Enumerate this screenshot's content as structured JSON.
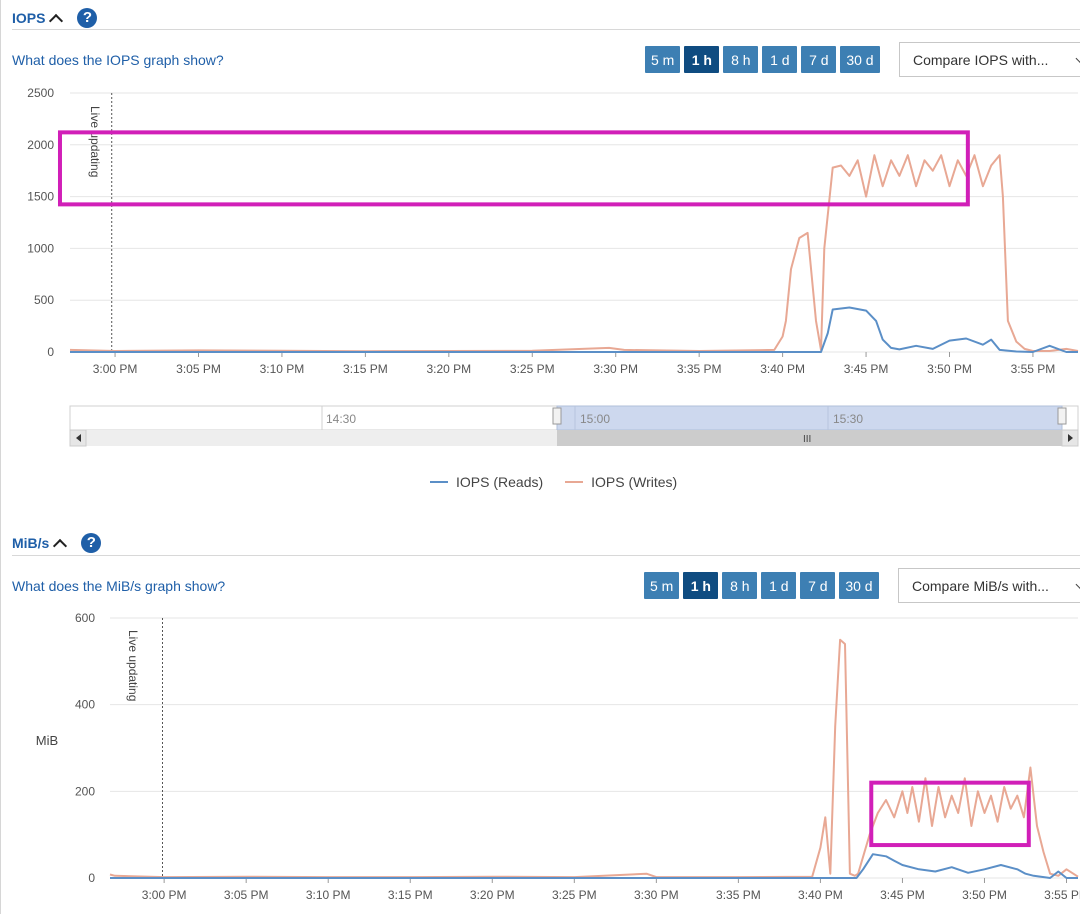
{
  "sections": [
    {
      "title": "IOPS",
      "help_link": "What does the IOPS graph show?",
      "ranges": [
        "5 m",
        "1 h",
        "8 h",
        "1 d",
        "7 d",
        "30 d"
      ],
      "active_range": "1 h",
      "compare_label": "Compare IOPS with...",
      "live_label": "Live updating"
    },
    {
      "title": "MiB/s",
      "help_link": "What does the MiB/s graph show?",
      "ranges": [
        "5 m",
        "1 h",
        "8 h",
        "1 d",
        "7 d",
        "30 d"
      ],
      "active_range": "1 h",
      "compare_label": "Compare MiB/s with...",
      "live_label": "Live updating"
    }
  ],
  "navigator": {
    "labels": [
      "14:30",
      "15:00",
      "15:30"
    ]
  },
  "legend": [
    {
      "name": "IOPS (Reads)",
      "color": "#5b8fc7"
    },
    {
      "name": "IOPS (Writes)",
      "color": "#e8a894"
    }
  ],
  "colors": {
    "reads": "#5b8fc7",
    "writes": "#e8a894",
    "highlight": "#d11fb8",
    "accent": "#1f5fa8"
  },
  "chart_data": [
    {
      "type": "line",
      "ylabel": "",
      "ylim": [
        0,
        2500
      ],
      "yticks": [
        0,
        500,
        1000,
        1500,
        2000,
        2500
      ],
      "xlim": [
        -2.7,
        57.7
      ],
      "xticks": [
        "3:00 PM",
        "3:05 PM",
        "3:10 PM",
        "3:15 PM",
        "3:20 PM",
        "3:25 PM",
        "3:30 PM",
        "3:35 PM",
        "3:40 PM",
        "3:45 PM",
        "3:50 PM",
        "3:55 PM"
      ],
      "xtick_minutes": [
        0,
        5,
        10,
        15,
        20,
        25,
        30,
        35,
        40,
        45,
        50,
        55
      ],
      "live_marker_minute": -0.2,
      "highlight": {
        "x0": -3.3,
        "x1": 51.1,
        "y0": 1425,
        "y1": 2120
      },
      "series": [
        {
          "name": "IOPS (Reads)",
          "x": [
            -2.7,
            40.0,
            42.3,
            42.7,
            43.0,
            44.0,
            45.0,
            45.6,
            46.0,
            46.5,
            47.0,
            48.0,
            49.0,
            50.0,
            51.0,
            52.0,
            52.5,
            53.0,
            54.0,
            55.0,
            56.0,
            57.0,
            57.7
          ],
          "values": [
            0,
            0,
            0,
            180,
            410,
            430,
            400,
            300,
            120,
            40,
            25,
            60,
            30,
            110,
            130,
            70,
            120,
            20,
            5,
            0,
            60,
            0,
            0
          ]
        },
        {
          "name": "IOPS (Writes)",
          "x": [
            -2.7,
            0,
            5,
            10,
            15,
            20,
            25,
            29.6,
            30.5,
            35,
            39.5,
            40.0,
            40.2,
            40.5,
            41.0,
            41.5,
            42.0,
            42.3,
            42.5,
            43.0,
            43.5,
            44.0,
            44.5,
            45.0,
            45.5,
            46.0,
            46.5,
            47.0,
            47.5,
            48.0,
            48.5,
            49.0,
            49.5,
            50.0,
            50.5,
            51.0,
            51.5,
            52.0,
            52.5,
            53.0,
            53.2,
            53.5,
            54.0,
            54.5,
            55.0,
            56.0,
            57.0,
            57.7
          ],
          "values": [
            20,
            10,
            15,
            12,
            8,
            10,
            12,
            40,
            20,
            10,
            20,
            150,
            300,
            800,
            1100,
            1150,
            300,
            20,
            1000,
            1780,
            1800,
            1700,
            1850,
            1500,
            1900,
            1600,
            1850,
            1700,
            1900,
            1600,
            1850,
            1750,
            1900,
            1600,
            1850,
            1700,
            1900,
            1600,
            1800,
            1900,
            1500,
            300,
            100,
            30,
            10,
            10,
            30,
            10
          ]
        }
      ]
    },
    {
      "type": "line",
      "ylabel": "MiB",
      "ylim": [
        0,
        600
      ],
      "yticks": [
        0,
        200,
        400,
        600
      ],
      "xlim": [
        -3.3,
        55.7
      ],
      "xticks": [
        "3:00 PM",
        "3:05 PM",
        "3:10 PM",
        "3:15 PM",
        "3:20 PM",
        "3:25 PM",
        "3:30 PM",
        "3:35 PM",
        "3:40 PM",
        "3:45 PM",
        "3:50 PM",
        "3:55 PM"
      ],
      "xtick_minutes": [
        0,
        5,
        10,
        15,
        20,
        25,
        30,
        35,
        40,
        45,
        50,
        55
      ],
      "live_marker_minute": -0.1,
      "highlight": {
        "x0": 43.1,
        "x1": 52.7,
        "y0": 76,
        "y1": 220
      },
      "series": [
        {
          "name": "IOPS (Reads)",
          "x": [
            -3.3,
            40.0,
            42.2,
            42.6,
            43.2,
            44.0,
            44.5,
            45.0,
            46.0,
            47.0,
            48.0,
            49.0,
            50.0,
            51.0,
            52.0,
            52.5,
            53.0,
            54.0,
            54.5,
            55.0,
            55.7
          ],
          "values": [
            0,
            0,
            0,
            20,
            55,
            50,
            40,
            30,
            20,
            15,
            25,
            12,
            20,
            30,
            20,
            10,
            5,
            0,
            15,
            0,
            0
          ]
        },
        {
          "name": "IOPS (Writes)",
          "x": [
            -3.3,
            -3.0,
            0,
            5,
            10,
            15,
            20,
            25,
            29.4,
            30.0,
            35,
            39.5,
            40.0,
            40.3,
            40.6,
            40.9,
            41.2,
            41.5,
            41.8,
            42.1,
            42.3,
            43.0,
            43.5,
            44.0,
            44.5,
            45.0,
            45.3,
            45.6,
            46.0,
            46.4,
            46.8,
            47.2,
            47.6,
            48.0,
            48.4,
            48.8,
            49.2,
            49.6,
            50.0,
            50.4,
            50.8,
            51.2,
            51.6,
            52.0,
            52.4,
            52.8,
            53.2,
            53.6,
            54.0,
            54.5,
            55.0,
            55.7
          ],
          "values": [
            8,
            5,
            2,
            3,
            2,
            2,
            3,
            2,
            10,
            2,
            2,
            3,
            70,
            140,
            10,
            350,
            550,
            540,
            10,
            5,
            10,
            100,
            150,
            180,
            140,
            200,
            150,
            210,
            130,
            230,
            120,
            210,
            140,
            190,
            150,
            230,
            120,
            200,
            150,
            190,
            130,
            210,
            160,
            190,
            140,
            255,
            120,
            60,
            10,
            5,
            20,
            3
          ]
        }
      ]
    }
  ]
}
